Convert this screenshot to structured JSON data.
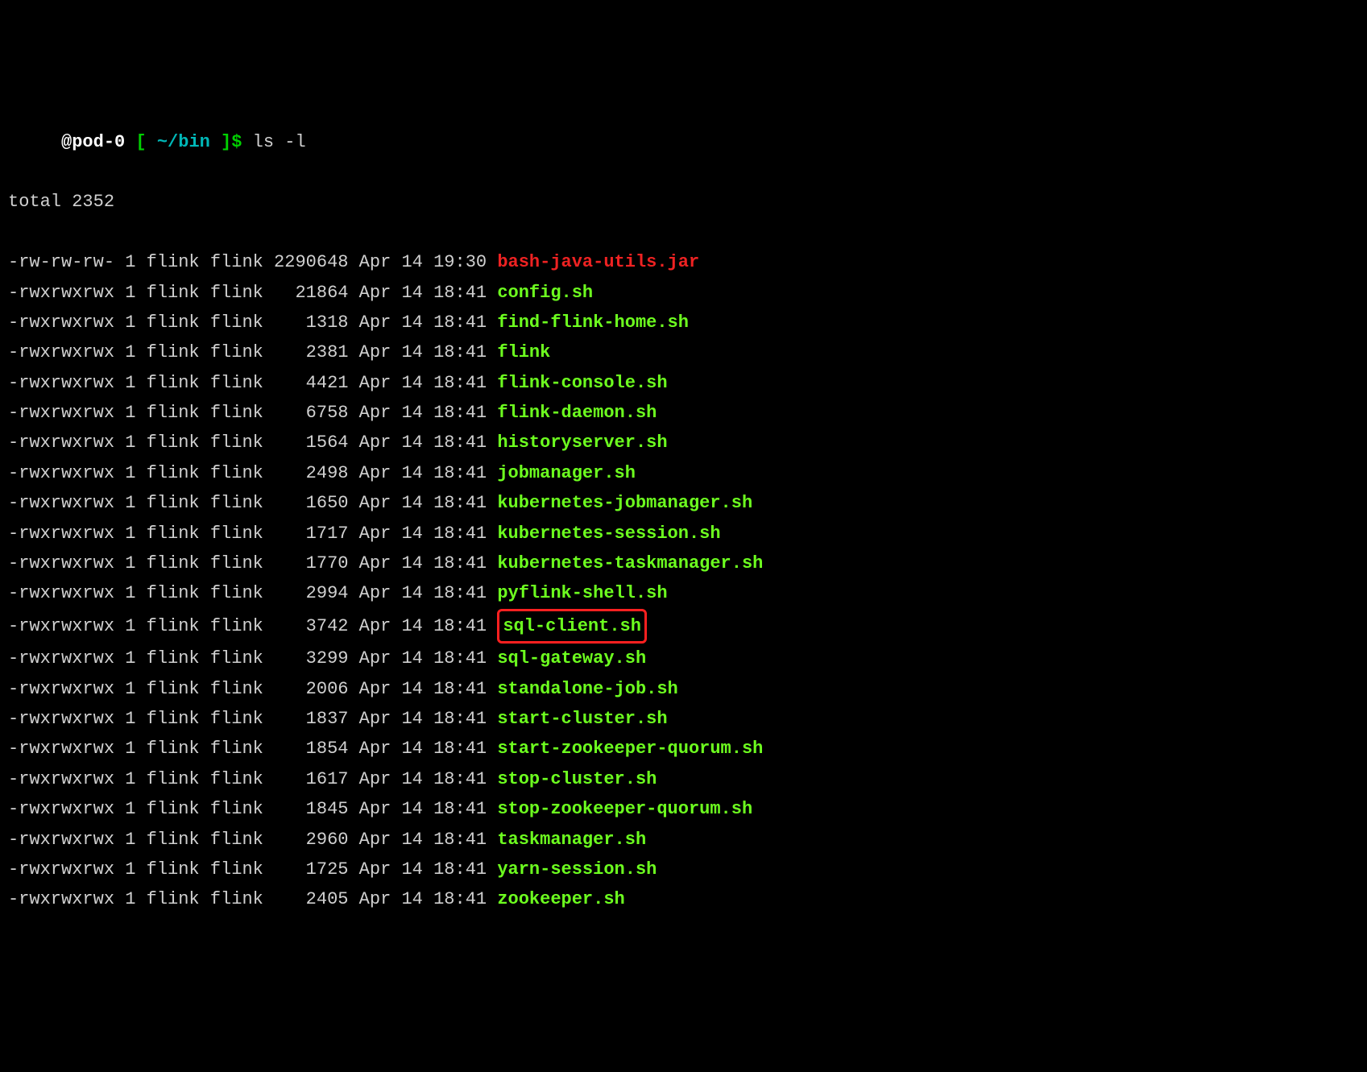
{
  "prompt": {
    "user_host": "@pod-0",
    "bracket_open": " [ ",
    "path": "~/bin",
    "bracket_close": " ]$ ",
    "command": "ls -l"
  },
  "total_line": "total 2352",
  "rows": [
    {
      "perms": "-rw-rw-rw-",
      "links": "1",
      "owner": "flink",
      "group": "flink",
      "size": "2290648",
      "month": "Apr",
      "day": "14",
      "time": "19:30",
      "name": "bash-java-utils.jar",
      "type": "reg",
      "highlighted": false
    },
    {
      "perms": "-rwxrwxrwx",
      "links": "1",
      "owner": "flink",
      "group": "flink",
      "size": "21864",
      "month": "Apr",
      "day": "14",
      "time": "18:41",
      "name": "config.sh",
      "type": "exec",
      "highlighted": false
    },
    {
      "perms": "-rwxrwxrwx",
      "links": "1",
      "owner": "flink",
      "group": "flink",
      "size": "1318",
      "month": "Apr",
      "day": "14",
      "time": "18:41",
      "name": "find-flink-home.sh",
      "type": "exec",
      "highlighted": false
    },
    {
      "perms": "-rwxrwxrwx",
      "links": "1",
      "owner": "flink",
      "group": "flink",
      "size": "2381",
      "month": "Apr",
      "day": "14",
      "time": "18:41",
      "name": "flink",
      "type": "exec",
      "highlighted": false
    },
    {
      "perms": "-rwxrwxrwx",
      "links": "1",
      "owner": "flink",
      "group": "flink",
      "size": "4421",
      "month": "Apr",
      "day": "14",
      "time": "18:41",
      "name": "flink-console.sh",
      "type": "exec",
      "highlighted": false
    },
    {
      "perms": "-rwxrwxrwx",
      "links": "1",
      "owner": "flink",
      "group": "flink",
      "size": "6758",
      "month": "Apr",
      "day": "14",
      "time": "18:41",
      "name": "flink-daemon.sh",
      "type": "exec",
      "highlighted": false
    },
    {
      "perms": "-rwxrwxrwx",
      "links": "1",
      "owner": "flink",
      "group": "flink",
      "size": "1564",
      "month": "Apr",
      "day": "14",
      "time": "18:41",
      "name": "historyserver.sh",
      "type": "exec",
      "highlighted": false
    },
    {
      "perms": "-rwxrwxrwx",
      "links": "1",
      "owner": "flink",
      "group": "flink",
      "size": "2498",
      "month": "Apr",
      "day": "14",
      "time": "18:41",
      "name": "jobmanager.sh",
      "type": "exec",
      "highlighted": false
    },
    {
      "perms": "-rwxrwxrwx",
      "links": "1",
      "owner": "flink",
      "group": "flink",
      "size": "1650",
      "month": "Apr",
      "day": "14",
      "time": "18:41",
      "name": "kubernetes-jobmanager.sh",
      "type": "exec",
      "highlighted": false
    },
    {
      "perms": "-rwxrwxrwx",
      "links": "1",
      "owner": "flink",
      "group": "flink",
      "size": "1717",
      "month": "Apr",
      "day": "14",
      "time": "18:41",
      "name": "kubernetes-session.sh",
      "type": "exec",
      "highlighted": false
    },
    {
      "perms": "-rwxrwxrwx",
      "links": "1",
      "owner": "flink",
      "group": "flink",
      "size": "1770",
      "month": "Apr",
      "day": "14",
      "time": "18:41",
      "name": "kubernetes-taskmanager.sh",
      "type": "exec",
      "highlighted": false
    },
    {
      "perms": "-rwxrwxrwx",
      "links": "1",
      "owner": "flink",
      "group": "flink",
      "size": "2994",
      "month": "Apr",
      "day": "14",
      "time": "18:41",
      "name": "pyflink-shell.sh",
      "type": "exec",
      "highlighted": false
    },
    {
      "perms": "-rwxrwxrwx",
      "links": "1",
      "owner": "flink",
      "group": "flink",
      "size": "3742",
      "month": "Apr",
      "day": "14",
      "time": "18:41",
      "name": "sql-client.sh",
      "type": "exec",
      "highlighted": true
    },
    {
      "perms": "-rwxrwxrwx",
      "links": "1",
      "owner": "flink",
      "group": "flink",
      "size": "3299",
      "month": "Apr",
      "day": "14",
      "time": "18:41",
      "name": "sql-gateway.sh",
      "type": "exec",
      "highlighted": false
    },
    {
      "perms": "-rwxrwxrwx",
      "links": "1",
      "owner": "flink",
      "group": "flink",
      "size": "2006",
      "month": "Apr",
      "day": "14",
      "time": "18:41",
      "name": "standalone-job.sh",
      "type": "exec",
      "highlighted": false
    },
    {
      "perms": "-rwxrwxrwx",
      "links": "1",
      "owner": "flink",
      "group": "flink",
      "size": "1837",
      "month": "Apr",
      "day": "14",
      "time": "18:41",
      "name": "start-cluster.sh",
      "type": "exec",
      "highlighted": false
    },
    {
      "perms": "-rwxrwxrwx",
      "links": "1",
      "owner": "flink",
      "group": "flink",
      "size": "1854",
      "month": "Apr",
      "day": "14",
      "time": "18:41",
      "name": "start-zookeeper-quorum.sh",
      "type": "exec",
      "highlighted": false
    },
    {
      "perms": "-rwxrwxrwx",
      "links": "1",
      "owner": "flink",
      "group": "flink",
      "size": "1617",
      "month": "Apr",
      "day": "14",
      "time": "18:41",
      "name": "stop-cluster.sh",
      "type": "exec",
      "highlighted": false
    },
    {
      "perms": "-rwxrwxrwx",
      "links": "1",
      "owner": "flink",
      "group": "flink",
      "size": "1845",
      "month": "Apr",
      "day": "14",
      "time": "18:41",
      "name": "stop-zookeeper-quorum.sh",
      "type": "exec",
      "highlighted": false
    },
    {
      "perms": "-rwxrwxrwx",
      "links": "1",
      "owner": "flink",
      "group": "flink",
      "size": "2960",
      "month": "Apr",
      "day": "14",
      "time": "18:41",
      "name": "taskmanager.sh",
      "type": "exec",
      "highlighted": false
    },
    {
      "perms": "-rwxrwxrwx",
      "links": "1",
      "owner": "flink",
      "group": "flink",
      "size": "1725",
      "month": "Apr",
      "day": "14",
      "time": "18:41",
      "name": "yarn-session.sh",
      "type": "exec",
      "highlighted": false
    },
    {
      "perms": "-rwxrwxrwx",
      "links": "1",
      "owner": "flink",
      "group": "flink",
      "size": "2405",
      "month": "Apr",
      "day": "14",
      "time": "18:41",
      "name": "zookeeper.sh",
      "type": "exec",
      "highlighted": false
    }
  ]
}
